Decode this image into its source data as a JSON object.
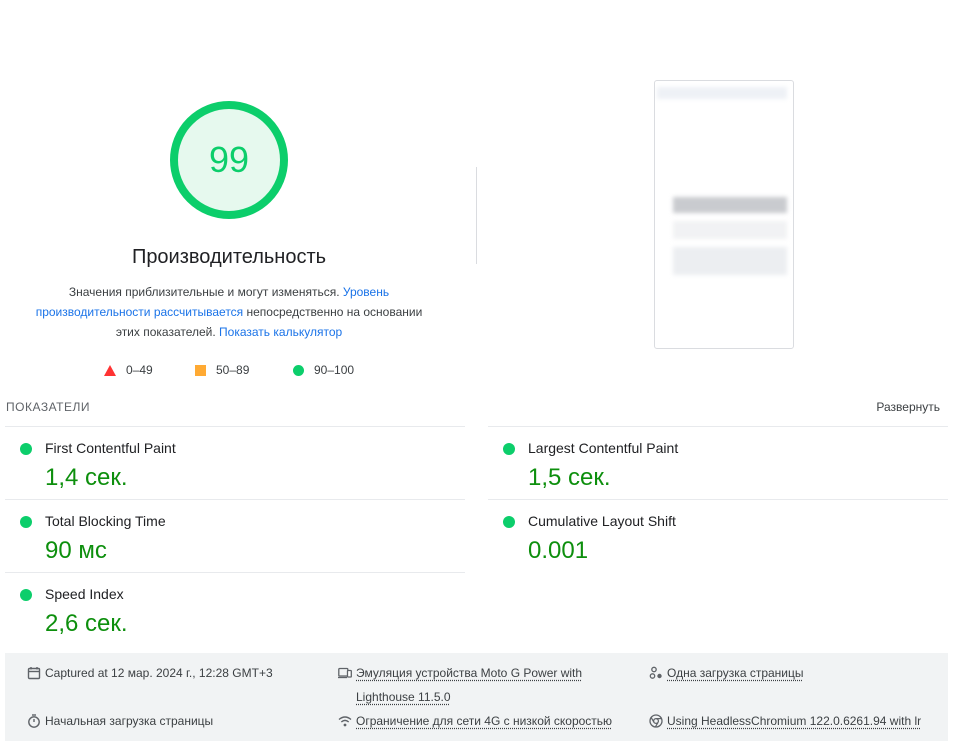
{
  "score": {
    "value": "99",
    "label": "Производительность",
    "color": "#0cce6b"
  },
  "description": {
    "text1": "Значения приблизительные и могут изменяться. ",
    "link1": "Уровень производительности рассчитывается",
    "text2": " непосредственно на основании этих показателей. ",
    "link2": "Показать калькулятор"
  },
  "legend": [
    {
      "range": "0–49",
      "shape": "triangle",
      "color": "#ff3333"
    },
    {
      "range": "50–89",
      "shape": "square",
      "color": "#ffaa33"
    },
    {
      "range": "90–100",
      "shape": "circle",
      "color": "#0cce6b"
    }
  ],
  "metrics_header": "ПОКАЗАТЕЛИ",
  "expand_label": "Развернуть",
  "metrics": [
    {
      "title": "First Contentful Paint",
      "value": "1,4 сек."
    },
    {
      "title": "Largest Contentful Paint",
      "value": "1,5 сек."
    },
    {
      "title": "Total Blocking Time",
      "value": "90 мс"
    },
    {
      "title": "Cumulative Layout Shift",
      "value": "0.001"
    },
    {
      "title": "Speed Index",
      "value": "2,6 сек."
    }
  ],
  "metric_status_color": "#0cce6b",
  "metric_value_color": "#0d8f0d",
  "footer": {
    "captured": "Captured at 12 мар. 2024 г., 12:28 GMT+3",
    "device_line1": "Эмуляция устройства Moto G Power with",
    "device_line2": "Lighthouse 11.5.0",
    "single_load": "Одна загрузка страницы",
    "initial_load": "Начальная загрузка страницы",
    "throttling": "Ограничение для сети 4G с низкой скоростью",
    "browser": "Using HeadlessChromium 122.0.6261.94 with lr"
  },
  "icons": {
    "calendar": "calendar-icon",
    "device": "device-icon",
    "runs": "single-run-icon",
    "timer": "timer-icon",
    "network": "network-icon",
    "chrome": "chrome-icon"
  }
}
